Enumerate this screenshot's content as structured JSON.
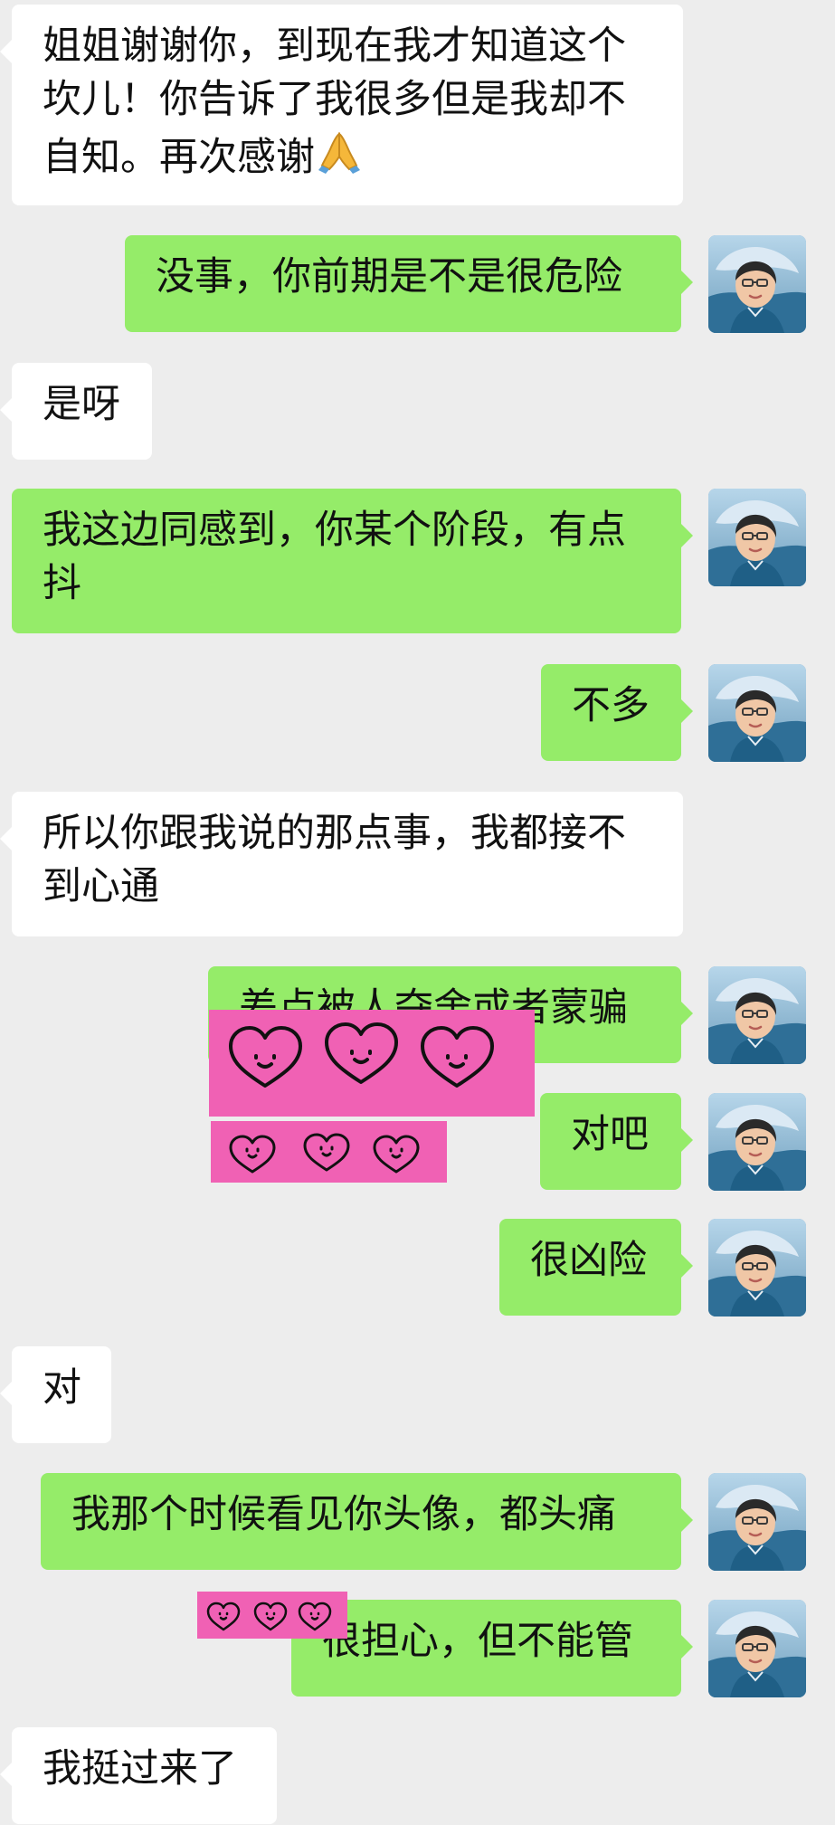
{
  "colors": {
    "background": "#ededed",
    "incoming_bubble": "#ffffff",
    "outgoing_bubble": "#95ec69",
    "sticker_fill": "#f061b4"
  },
  "messages": [
    {
      "id": "m1",
      "direction": "incoming",
      "text": "姐姐谢谢你，到现在我才知道这个坎儿！你告诉了我很多但是我却不自知。再次感谢",
      "emoji": "folded-hands"
    },
    {
      "id": "m2",
      "direction": "outgoing",
      "text": "没事，你前期是不是很危险"
    },
    {
      "id": "m3",
      "direction": "incoming",
      "text": "是呀"
    },
    {
      "id": "m4",
      "direction": "outgoing",
      "text": "我这边同感到，你某个阶段，有点抖"
    },
    {
      "id": "m5",
      "direction": "outgoing",
      "text": "不多"
    },
    {
      "id": "m6",
      "direction": "incoming",
      "text": "所以你跟我说的那点事，我都接不到心通"
    },
    {
      "id": "m7",
      "direction": "outgoing",
      "text": "差点被人夺舍或者蒙骗"
    },
    {
      "id": "m8",
      "direction": "outgoing",
      "text": "对吧"
    },
    {
      "id": "m9",
      "direction": "outgoing",
      "text": "很凶险"
    },
    {
      "id": "m10",
      "direction": "incoming",
      "text": "对"
    },
    {
      "id": "m11",
      "direction": "outgoing",
      "text": "我那个时候看见你头像，都头痛"
    },
    {
      "id": "m12",
      "direction": "outgoing",
      "text": "很担心，但不能管"
    },
    {
      "id": "m13",
      "direction": "incoming",
      "text": "我挺过来了"
    }
  ],
  "icons": {
    "avatar": "profile-photo-woman-with-hat",
    "sticker": "smiling-hearts-icon",
    "emoji": "folded-hands-icon"
  }
}
